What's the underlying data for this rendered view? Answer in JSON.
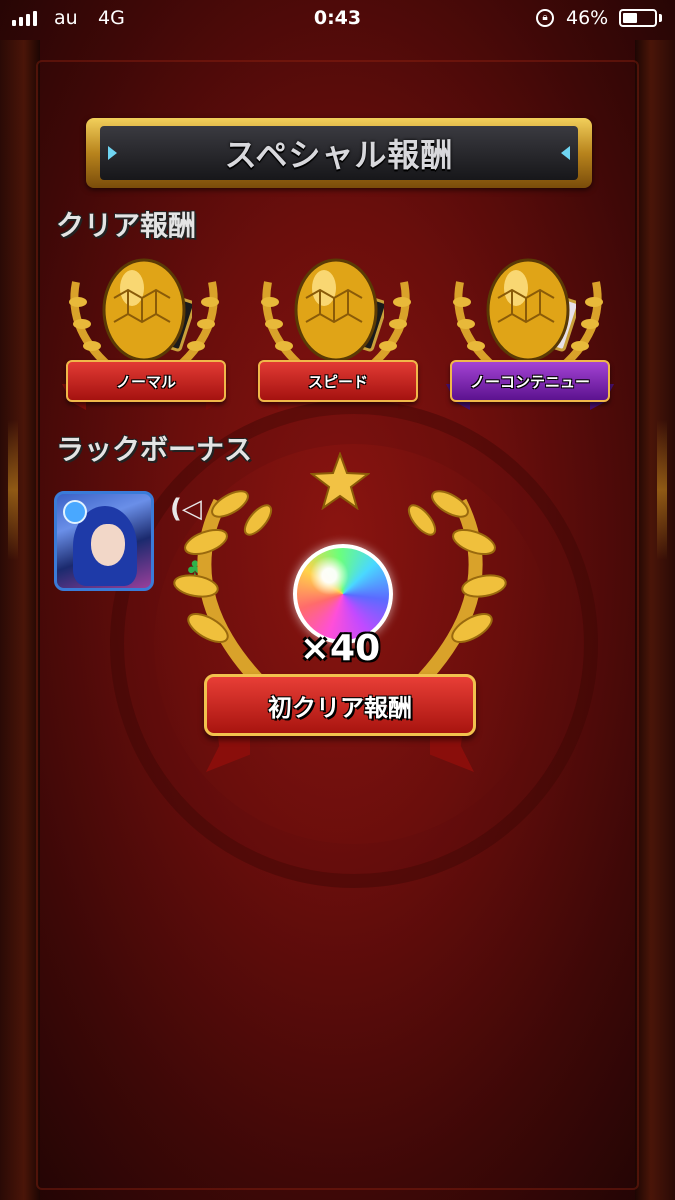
{
  "status_bar": {
    "carrier": "au",
    "network": "4G",
    "time": "0:43",
    "battery_percent": "46%",
    "battery_level": 0.46,
    "icons": [
      "signal-icon",
      "rotation-lock-icon",
      "battery-icon"
    ]
  },
  "header": {
    "title": "スペシャル報酬"
  },
  "clear_rewards": {
    "title": "クリア報酬",
    "items": [
      {
        "label": "ノーマル",
        "ribbon_color": "#c0201b",
        "icon": "golden-egg-icon"
      },
      {
        "label": "スピード",
        "ribbon_color": "#c0201b",
        "icon": "golden-egg-icon"
      },
      {
        "label": "ノーコンテニュー",
        "ribbon_color": "#7a1fb0",
        "icon": "golden-egg-icon"
      }
    ]
  },
  "luck_bonus": {
    "title": "ラックボーナス",
    "partial_text": "(◁",
    "icons": [
      "character-portrait-icon",
      "clover-icon"
    ]
  },
  "popup": {
    "quantity": "×40",
    "label": "初クリア報酬",
    "icon": "rainbow-orb-icon"
  },
  "colors": {
    "background": "#6a0e0c",
    "gold": "#d9a22a",
    "ribbon_red": "#c0201b",
    "ribbon_purple": "#7a1fb0"
  }
}
